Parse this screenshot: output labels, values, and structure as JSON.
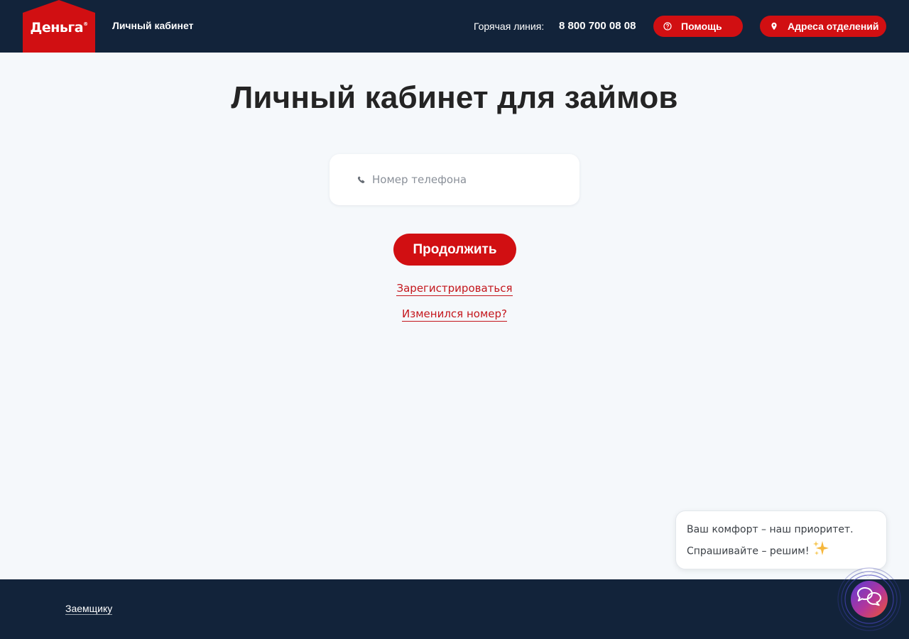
{
  "header": {
    "logo_text": "Деньга",
    "logo_mark": "®",
    "cabinet_link": "Личный кабинет",
    "hotline_label": "Горячая линия:",
    "hotline_number": "8 800 700 08 08",
    "help_button": "Помощь",
    "help_icon": "question-circle-icon",
    "address_button": "Адреса отделений",
    "address_icon": "map-pin-icon"
  },
  "main": {
    "title": "Личный кабинет для займов",
    "phone_placeholder": "Номер телефона",
    "phone_value": "",
    "phone_icon": "phone-icon",
    "continue_button": "Продолжить",
    "register_link": "Зарегистрироваться",
    "changed_number_link": "Изменился номер?"
  },
  "footer": {
    "borrower_link": "Заемщику"
  },
  "chat": {
    "line1": "Ваш комфорт – наш приоритет.",
    "line2": "Спрашивайте – решим!",
    "emoji_icon": "sparkles-icon",
    "launcher_icon": "chat-bubbles-icon"
  },
  "colors": {
    "brand_red": "#d10f12",
    "header_bg": "#12233a",
    "page_bg": "#f5f8fb",
    "link_red": "#c4161c"
  }
}
